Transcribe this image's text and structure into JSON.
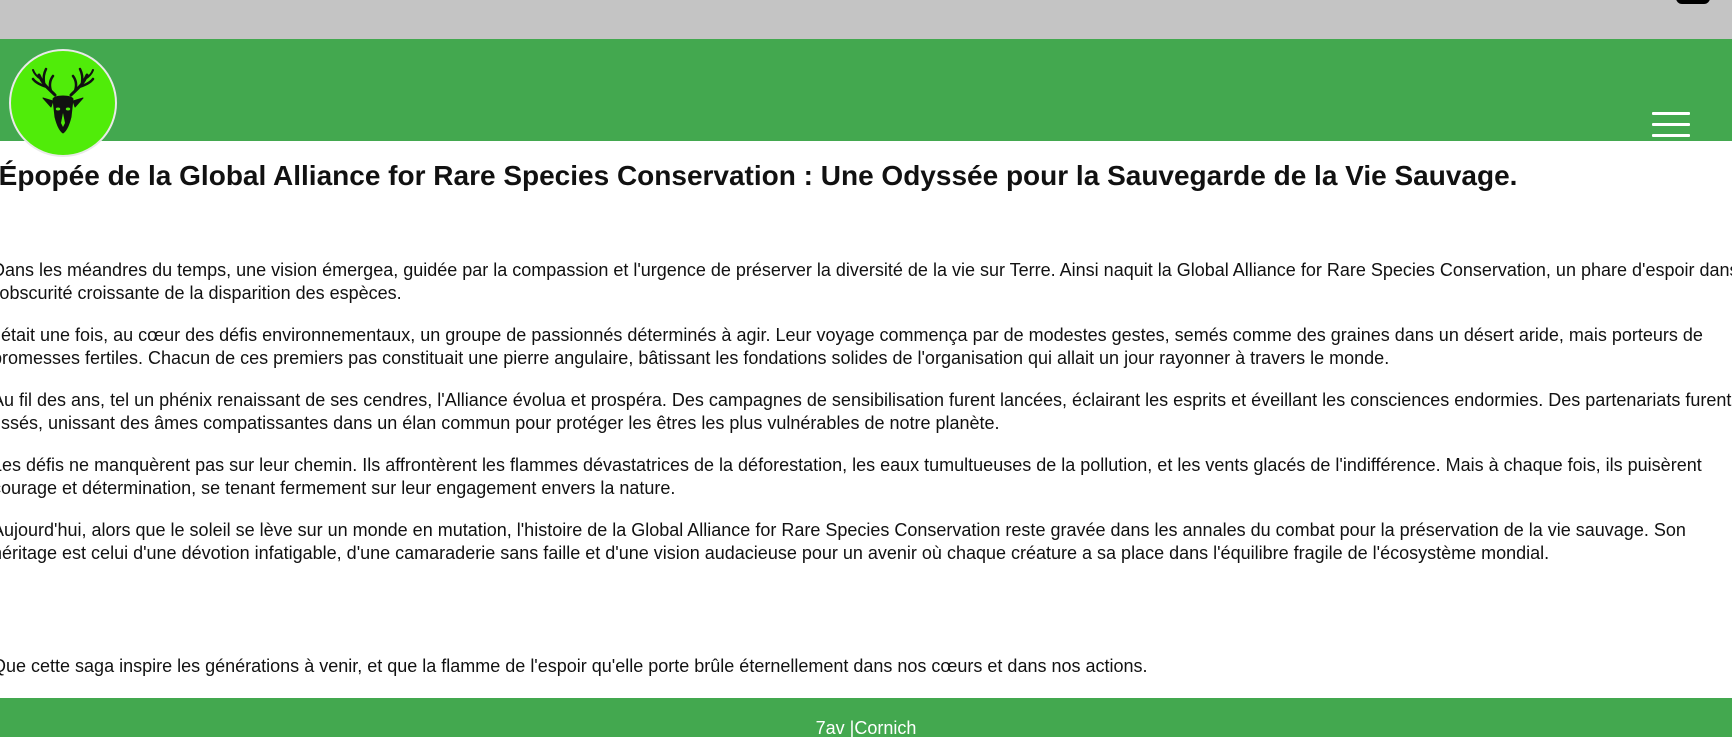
{
  "header": {
    "logo_icon": "deer-head-icon",
    "menu_icon": "hamburger-menu-icon",
    "colors": {
      "header_bg": "#43a84f",
      "logo_bg": "#50ec09"
    }
  },
  "main": {
    "title": "'Épopée de la Global Alliance for Rare Species Conservation : Une Odyssée pour la Sauvegarde de la Vie Sauvage.",
    "paragraphs": [
      "Dans les méandres du temps, une vision émergea, guidée par la compassion et l'urgence de préserver la diversité de la vie sur Terre. Ainsi naquit la Global Alliance for Rare Species Conservation, un phare d'espoir dans l'obscurité croissante de la disparition des espèces.",
      "l était une fois, au cœur des défis environnementaux, un groupe de passionnés déterminés à agir. Leur voyage commença par de modestes gestes, semés comme des graines dans un désert aride, mais porteurs de promesses fertiles. Chacun de ces premiers pas constituait une pierre angulaire, bâtissant les fondations solides de l'organisation qui allait un jour rayonner à travers le monde.",
      "Au fil des ans, tel un phénix renaissant de ses cendres, l'Alliance évolua et prospéra. Des campagnes de sensibilisation furent lancées, éclairant les esprits et éveillant les consciences endormies. Des partenariats furent tissés, unissant des âmes compatissantes dans un élan commun pour protéger les êtres les plus vulnérables de notre planète.",
      "Les défis ne manquèrent pas sur leur chemin. Ils affrontèrent les flammes dévastatrices de la déforestation, les eaux tumultueuses de la pollution, et les vents glacés de l'indifférence. Mais à chaque fois, ils puisèrent courage et détermination, se tenant fermement sur leur engagement envers la nature.",
      "Aujourd'hui, alors que le soleil se lève sur un monde en mutation, l'histoire de la Global Alliance for Rare Species Conservation reste gravée dans les annales du combat pour la préservation de la vie sauvage. Son héritage est celui d'une dévotion infatigable, d'une camaraderie sans faille et d'une vision audacieuse pour un avenir où chaque créature a sa place dans l'équilibre fragile de l'écosystème mondial."
    ],
    "closing": "Que cette saga inspire les générations à venir, et que la flamme de l'espoir qu'elle porte brûle éternellement dans nos cœurs et dans nos actions."
  },
  "footer": {
    "text": "7av |Cornich"
  }
}
